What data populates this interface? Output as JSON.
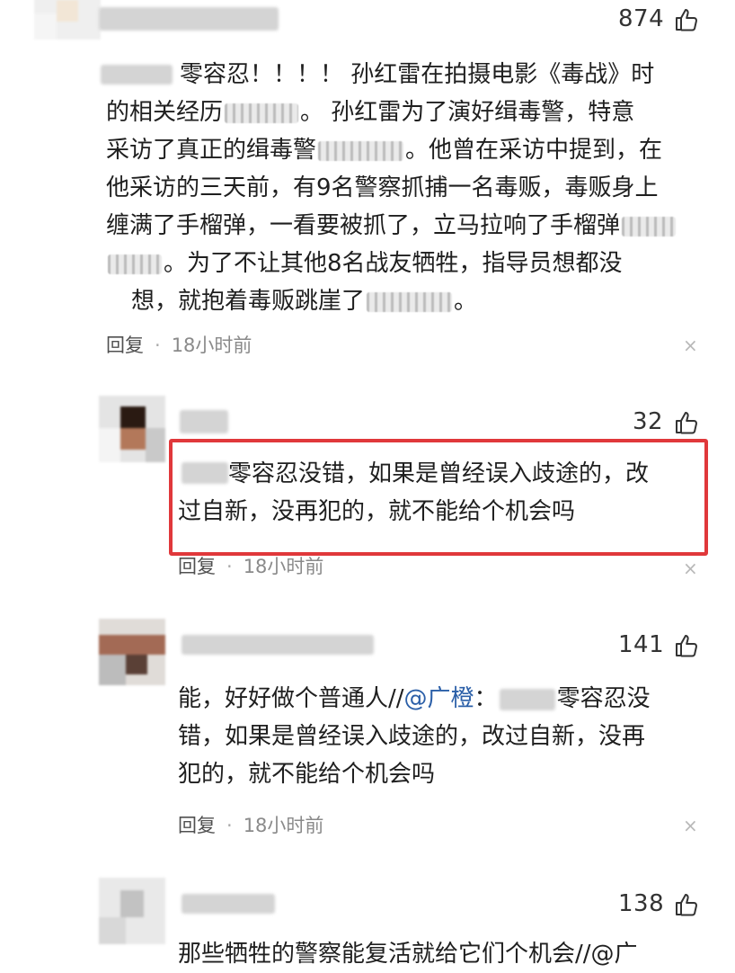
{
  "comments": [
    {
      "likes": "874",
      "text_parts": [
        "零容忍！！！！ 孙红雷在拍摄电影《毒战》时",
        "的相关经历",
        "。 孙红雷为了演好缉毒警，特意",
        "采访了真正的缉毒警",
        "。他曾在采访中提到，在",
        "他采访的三天前，有9名警察抓捕一名毒贩，毒贩身上",
        "缠满了手榴弹，一看要被抓了，立马拉响了手榴弹",
        "",
        "。为了不让其他8名战友牺牲，指导员想都没",
        "想，就抱着毒贩跳崖了",
        "。"
      ],
      "reply": "回复",
      "dot": "·",
      "time": "18小时前",
      "close": "×"
    },
    {
      "likes": "32",
      "text": [
        "零容忍没错，如果是曾经误入歧途的，改",
        "过自新，没再犯的，就不能给个机会吗"
      ],
      "reply": "回复",
      "dot": "·",
      "time": "18小时前",
      "close": "×"
    },
    {
      "likes": "141",
      "line1_prefix": "能，好好做个普通人//",
      "mention": "@广橙",
      "line1_colon": "：",
      "line1_suffix": "零容忍没",
      "text": [
        "错，如果是曾经误入歧途的，改过自新，没再",
        "犯的，就不能给个机会吗"
      ],
      "reply": "回复",
      "dot": "·",
      "time": "18小时前",
      "close": "×"
    },
    {
      "likes": "138",
      "text": "那些牺牲的警察能复活就给它们个机会//@广"
    }
  ],
  "colors": {
    "highlight": "#e0383b",
    "mention": "#2b5fa8",
    "meta": "#8a8a8a"
  }
}
